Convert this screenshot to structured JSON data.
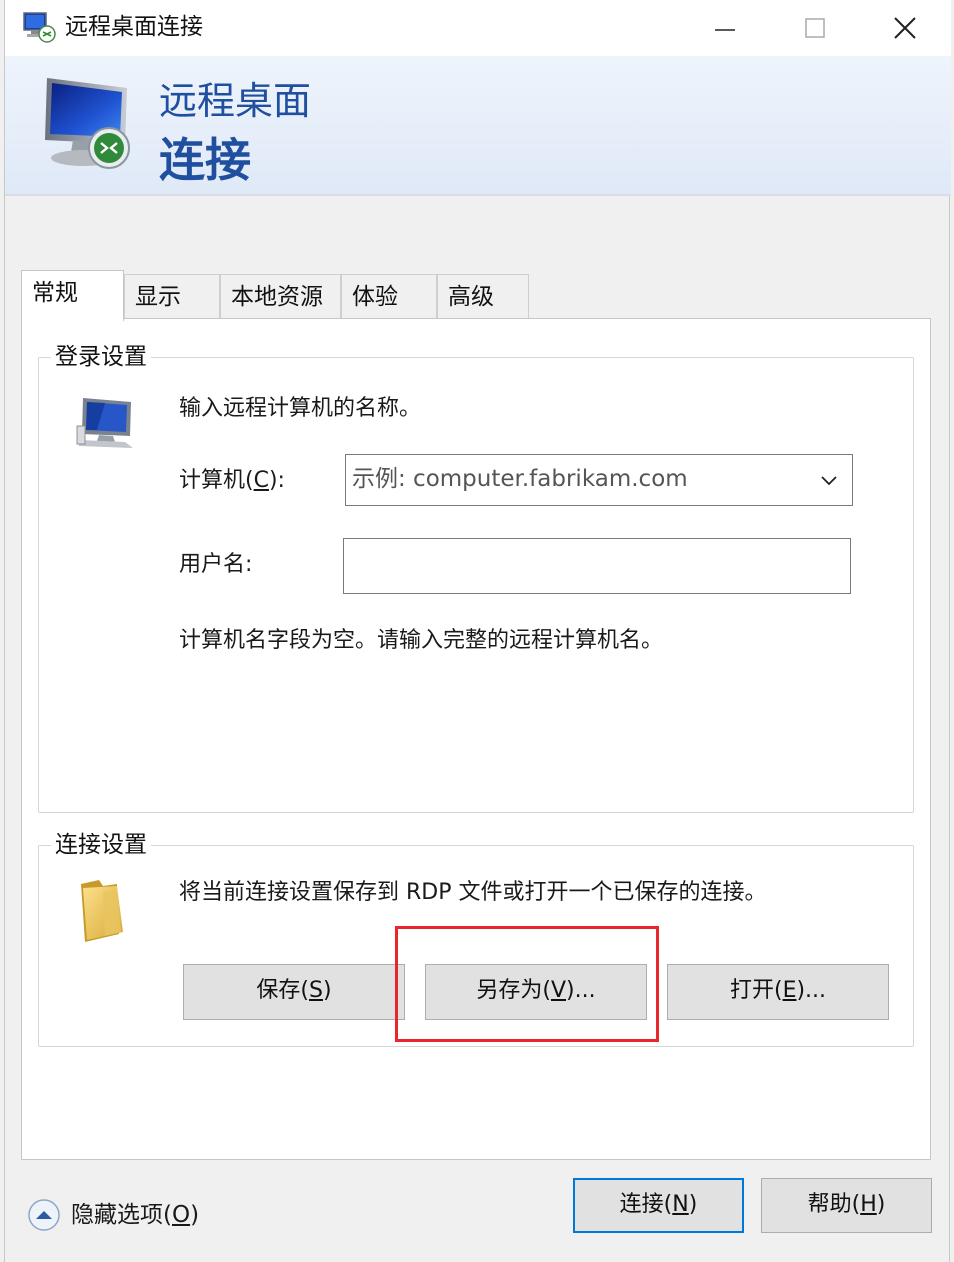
{
  "window": {
    "title": "远程桌面连接",
    "controls": {
      "minimize": "minimize",
      "maximize": "maximize",
      "close": "close"
    }
  },
  "banner": {
    "line1": "远程桌面",
    "line2": "连接"
  },
  "tabs": [
    {
      "label": "常规",
      "active": true
    },
    {
      "label": "显示",
      "active": false
    },
    {
      "label": "本地资源",
      "active": false
    },
    {
      "label": "体验",
      "active": false
    },
    {
      "label": "高级",
      "active": false
    }
  ],
  "login_settings": {
    "legend": "登录设置",
    "instruction": "输入远程计算机的名称。",
    "computer_label_prefix": "计算机(",
    "computer_label_key": "C",
    "computer_label_suffix": "):",
    "computer_placeholder": "示例: computer.fabrikam.com",
    "username_label": "用户名:",
    "username_value": "",
    "status_message": "计算机名字段为空。请输入完整的远程计算机名。"
  },
  "connection_settings": {
    "legend": "连接设置",
    "description": "将当前连接设置保存到 RDP 文件或打开一个已保存的连接。",
    "save_prefix": "保存(",
    "save_key": "S",
    "save_suffix": ")",
    "save_as_prefix": "另存为(",
    "save_as_key": "V",
    "save_as_suffix": ")...",
    "open_prefix": "打开(",
    "open_key": "E",
    "open_suffix": ")..."
  },
  "footer": {
    "hide_options_prefix": "隐藏选项(",
    "hide_options_key": "O",
    "hide_options_suffix": ")",
    "connect_prefix": "连接(",
    "connect_key": "N",
    "connect_suffix": ")",
    "help_prefix": "帮助(",
    "help_key": "H",
    "help_suffix": ")"
  },
  "colors": {
    "banner_text": "#1f4f9e",
    "highlight": "#e8262b",
    "default_button_border": "#0078d7"
  }
}
